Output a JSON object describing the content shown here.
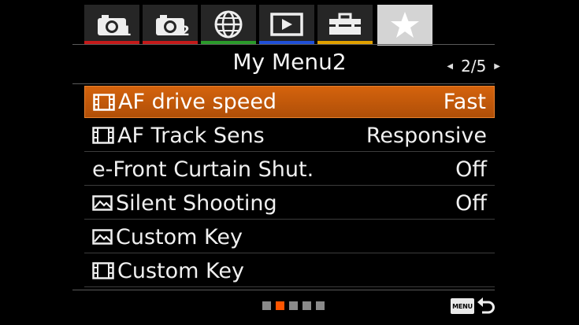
{
  "tabs": [
    {
      "icon": "camera-1-icon",
      "subscript": "1",
      "stripe": "#c41a1a"
    },
    {
      "icon": "camera-2-icon",
      "subscript": "2",
      "stripe": "#c41a1a"
    },
    {
      "icon": "globe-icon",
      "subscript": "",
      "stripe": "#2a9a2a"
    },
    {
      "icon": "playback-icon",
      "subscript": "",
      "stripe": "#1f4fd8"
    },
    {
      "icon": "toolbox-icon",
      "subscript": "",
      "stripe": "#e0a000"
    },
    {
      "icon": "star-icon",
      "subscript": "",
      "stripe": "#d4d4d4",
      "active": true
    }
  ],
  "header": {
    "title": "My Menu2",
    "page": "2/5"
  },
  "items": [
    {
      "icon": "movie-icon",
      "label": "AF drive speed",
      "value": "Fast",
      "selected": true
    },
    {
      "icon": "movie-icon",
      "label": "AF Track Sens",
      "value": "Responsive"
    },
    {
      "icon": "",
      "label": "e-Front Curtain Shut.",
      "value": "Off"
    },
    {
      "icon": "still-image-icon",
      "label": "Silent Shooting",
      "value": "Off"
    },
    {
      "icon": "still-image-icon",
      "label": "Custom Key",
      "value": ""
    },
    {
      "icon": "movie-icon",
      "label": "Custom Key",
      "value": ""
    }
  ],
  "pagination": {
    "total": 5,
    "current": 2
  },
  "footer": {
    "menu_label": "MENU"
  },
  "colors": {
    "selected": "#c75a0b",
    "active_dot": "#ff5500"
  }
}
